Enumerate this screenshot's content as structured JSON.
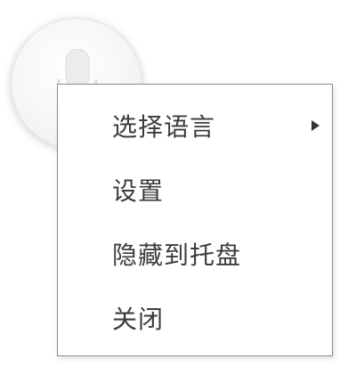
{
  "widget": {
    "icon": "microphone-icon"
  },
  "menu": {
    "items": [
      {
        "label": "选择语言",
        "has_submenu": true,
        "icon": "chevron-right-icon"
      },
      {
        "label": "设置",
        "has_submenu": false
      },
      {
        "label": "隐藏到托盘",
        "has_submenu": false
      },
      {
        "label": "关闭",
        "has_submenu": false
      }
    ]
  },
  "colors": {
    "menu_border": "#8d8d8d",
    "menu_text": "#3c3c3c",
    "menu_background": "#ffffff"
  }
}
